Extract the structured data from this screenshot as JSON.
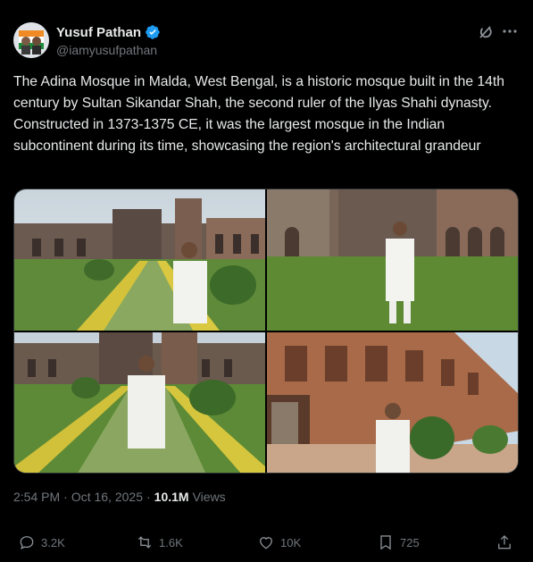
{
  "author": {
    "display_name": "Yusuf Pathan",
    "handle": "@iamyusufpathan",
    "verified": true,
    "verified_color": "#1d9bf0"
  },
  "tweet": {
    "text": "The Adina Mosque in Malda, West Bengal, is a historic mosque built in the 14th century by Sultan Sikandar Shah, the second ruler of the Ilyas Shahi dynasty. Constructed in 1373-1375 CE, it was the largest mosque in the Indian subcontinent during its time, showcasing the region's architectural grandeur",
    "time": "2:54 PM",
    "separator": "·",
    "date": "Oct 16, 2025",
    "views_count": "10.1M",
    "views_label": "Views"
  },
  "media": [
    {
      "icon": "photo-mosque-garden-wide"
    },
    {
      "icon": "photo-mosque-courtyard-standing"
    },
    {
      "icon": "photo-mosque-hedge-path"
    },
    {
      "icon": "photo-mosque-facade-closeup"
    }
  ],
  "actions": {
    "reply_count": "3.2K",
    "retweet_count": "1.6K",
    "like_count": "10K",
    "bookmark_count": "725"
  },
  "icons": [
    "grok-icon",
    "more-icon",
    "reply-icon",
    "retweet-icon",
    "like-icon",
    "bookmark-icon",
    "share-icon"
  ],
  "colors": {
    "background": "#000000",
    "text": "#e7e9ea",
    "secondary": "#71767b",
    "border": "#2f3336"
  }
}
